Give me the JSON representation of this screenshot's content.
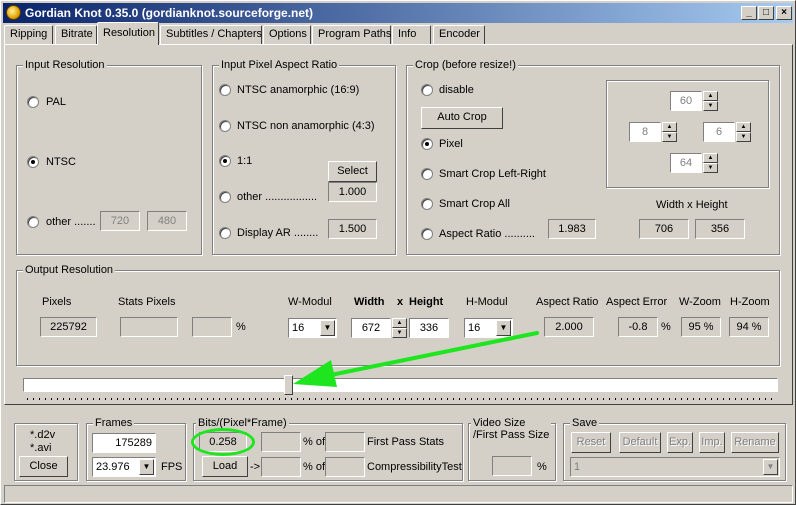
{
  "window": {
    "title": "Gordian Knot 0.35.0  (gordianknot.sourceforge.net)"
  },
  "tabs": [
    "Ripping",
    "Bitrate",
    "Resolution",
    "Subtitles / Chapters",
    "Options",
    "Program Paths",
    "Info",
    "Encoder"
  ],
  "input_resolution": {
    "title": "Input Resolution",
    "pal": "PAL",
    "ntsc": "NTSC",
    "other": "other .......",
    "other_w": "720",
    "other_h": "480"
  },
  "pixel_ar": {
    "title": "Input Pixel Aspect Ratio",
    "ntsc_ana": "NTSC anamorphic (16:9)",
    "ntsc_non": "NTSC non anamorphic (4:3)",
    "one": "1:1",
    "select": "Select",
    "other": "other .................",
    "other_val": "1.000",
    "display": "Display AR ........",
    "display_val": "1.500"
  },
  "crop": {
    "title": "Crop (before resize!)",
    "disable": "disable",
    "auto": "Auto Crop",
    "pixel": "Pixel",
    "smart_lr": "Smart Crop Left-Right",
    "smart_all": "Smart Crop All",
    "aspect": "Aspect Ratio  ..........",
    "aspect_val": "1.983",
    "top": "60",
    "left": "8",
    "right": "6",
    "bottom": "64",
    "wh_label": "Width x Height",
    "w": "706",
    "h": "356"
  },
  "output": {
    "title": "Output Resolution",
    "pixels_label": "Pixels",
    "pixels": "225792",
    "stats_label": "Stats Pixels",
    "stats": "",
    "stats_pct": "",
    "pct": "%",
    "wmodul_label": "W-Modul",
    "wmodul": "16",
    "width_label": "Width",
    "x_label": "x",
    "height_label": "Height",
    "width": "672",
    "height": "336",
    "hmodul_label": "H-Modul",
    "hmodul": "16",
    "ar_label": "Aspect Ratio",
    "ar": "2.000",
    "aerr_label": "Aspect Error",
    "aerr": "-0.8",
    "wzoom_label": "W-Zoom",
    "wzoom": "95 %",
    "hzoom_label": "H-Zoom",
    "hzoom": "94 %"
  },
  "slider": {
    "position": 0.35
  },
  "bottom": {
    "d2v": "*.d2v",
    "avi": "*.avi",
    "close": "Close",
    "frames_title": "Frames",
    "frames": "175289",
    "fps_val": "23.976",
    "fps": "FPS",
    "bits_title": "Bits/(Pixel*Frame)",
    "bits": "0.258",
    "of": "% of",
    "first_pass": "First Pass Stats",
    "load": "Load",
    "arrow": "->",
    "compress": "CompressibilityTest",
    "vsize_title": "Video Size\n/First Pass Size",
    "vsize_title_1": "Video Size",
    "vsize_title_2": "/First Pass Size",
    "vsize_pct": "%",
    "save_title": "Save",
    "reset": "Reset",
    "default": "Default",
    "exp": "Exp.",
    "imp": "Imp.",
    "rename": "Rename",
    "save_sel": "1"
  },
  "colors": {
    "annotation": "#1ee61e",
    "title_start": "#0a246a",
    "title_end": "#a6caf0"
  }
}
